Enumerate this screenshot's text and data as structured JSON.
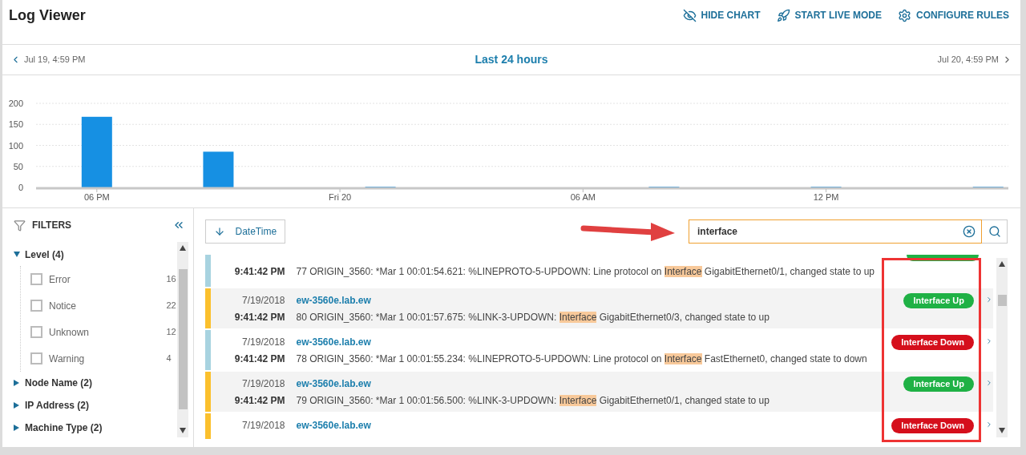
{
  "header": {
    "title": "Log Viewer",
    "actions": [
      {
        "kind": "hide",
        "label": "HIDE CHART"
      },
      {
        "kind": "live",
        "label": "START LIVE MODE"
      },
      {
        "kind": "rules",
        "label": "CONFIGURE RULES"
      }
    ]
  },
  "range": {
    "prev": "Jul 19, 4:59 PM",
    "title": "Last 24 hours",
    "next": "Jul 20, 4:59 PM"
  },
  "chart": {
    "chart_data": {
      "type": "bar",
      "categories": [
        null,
        "06 PM",
        null,
        null,
        null,
        null,
        null,
        "Fri 20",
        null,
        null,
        null,
        null,
        null,
        "06 AM",
        null,
        null,
        null,
        null,
        null,
        "12 PM",
        null,
        null,
        null,
        null
      ],
      "values": [
        0,
        168,
        0,
        0,
        85,
        0,
        0,
        0,
        1,
        0,
        0,
        0,
        0,
        0,
        0,
        1,
        0,
        0,
        0,
        1,
        0,
        0,
        0,
        1
      ],
      "ylim": [
        0,
        200
      ],
      "grid": true,
      "yticks": [
        0,
        50,
        100,
        150,
        200
      ]
    }
  },
  "filters": {
    "title": "FILTERS",
    "groups": [
      {
        "label": "Level (4)",
        "expanded": true,
        "items": [
          {
            "label": "Error",
            "count": "16",
            "checked": false
          },
          {
            "label": "Notice",
            "count": "22",
            "checked": false
          },
          {
            "label": "Unknown",
            "count": "12",
            "checked": false
          },
          {
            "label": "Warning",
            "count": "4",
            "checked": false
          }
        ]
      },
      {
        "label": "Node Name (2)",
        "expanded": false
      },
      {
        "label": "IP Address (2)",
        "expanded": false
      },
      {
        "label": "Machine Type (2)",
        "expanded": false
      }
    ]
  },
  "sort": {
    "label": "DateTime"
  },
  "search": {
    "value": "interface"
  },
  "rows": [
    {
      "kind": "partial",
      "color": "#a8d3e0",
      "time": "9:41:42 PM",
      "badge": {
        "color": "#1fb145"
      },
      "message": [
        {
          "text": "77 ORIGIN_3560: *Mar 1 00:01:54.621: %LINEPROTO-5-UPDOWN: Line protocol on ",
          "highlight": false
        },
        {
          "text": "Interface",
          "highlight": true
        },
        {
          "text": " GigabitEthernet0/1, changed state to up",
          "highlight": false
        }
      ]
    },
    {
      "kind": "full",
      "color": "#fbc02d",
      "date": "7/19/2018",
      "host": "ew-3560e.lab.ew",
      "time": "9:41:42 PM",
      "badge": {
        "text": "Interface Up",
        "color": "#1fb145"
      },
      "message": [
        {
          "text": "80 ORIGIN_3560: *Mar 1 00:01:57.675: %LINK-3-UPDOWN: ",
          "highlight": false
        },
        {
          "text": "Interface",
          "highlight": true
        },
        {
          "text": " GigabitEthernet0/3, changed state to up",
          "highlight": false
        }
      ]
    },
    {
      "kind": "full",
      "color": "#a8d3e0",
      "date": "7/19/2018",
      "host": "ew-3560e.lab.ew",
      "time": "9:41:42 PM",
      "badge": {
        "text": "Interface Down",
        "color": "#d50f1c"
      },
      "message": [
        {
          "text": "78 ORIGIN_3560: *Mar 1 00:01:55.234: %LINEPROTO-5-UPDOWN: Line protocol on ",
          "highlight": false
        },
        {
          "text": "Interface",
          "highlight": true
        },
        {
          "text": " FastEthernet0, changed state to down",
          "highlight": false
        }
      ]
    },
    {
      "kind": "full",
      "color": "#fbc02d",
      "date": "7/19/2018",
      "host": "ew-3560e.lab.ew",
      "time": "9:41:42 PM",
      "badge": {
        "text": "Interface Up",
        "color": "#1fb145"
      },
      "message": [
        {
          "text": "79 ORIGIN_3560: *Mar 1 00:01:56.500: %LINK-3-UPDOWN: ",
          "highlight": false
        },
        {
          "text": "Interface",
          "highlight": true
        },
        {
          "text": " GigabitEthernet0/1, changed state to up",
          "highlight": false
        }
      ]
    },
    {
      "kind": "top",
      "color": "#fbc02d",
      "date": "7/19/2018",
      "host": "ew-3560e.lab.ew",
      "badge": {
        "text": "Interface Down",
        "color": "#d50f1c"
      }
    }
  ]
}
